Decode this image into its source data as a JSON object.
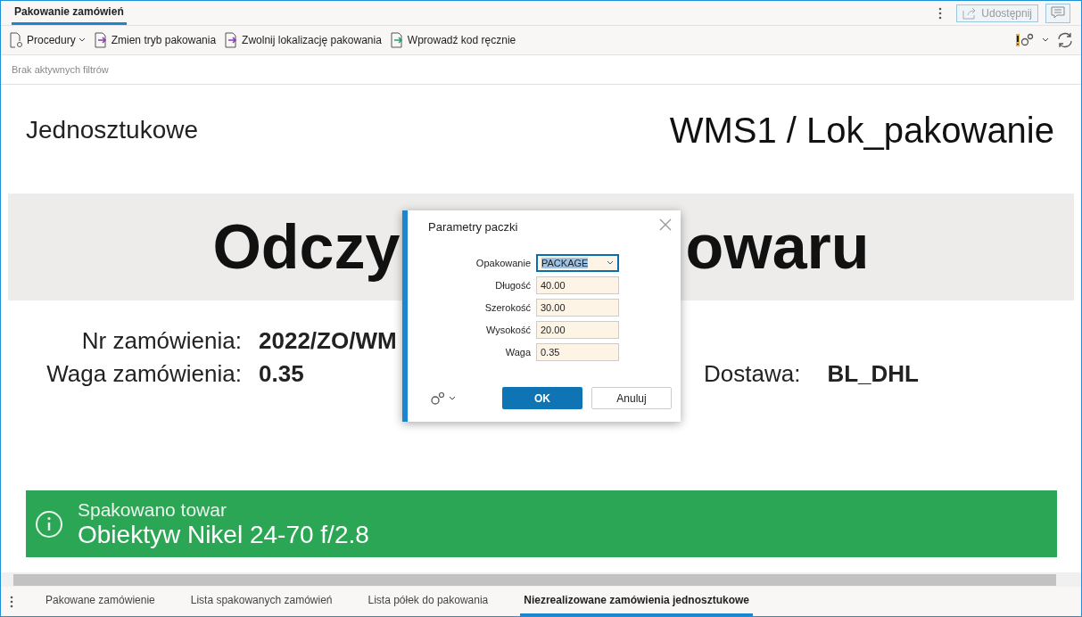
{
  "window": {
    "tabs": [
      {
        "label": "Pakowanie zamówień",
        "selected": true
      }
    ],
    "share_button": "Udostępnij"
  },
  "toolbar": {
    "items": [
      {
        "label": "Procedury",
        "kind": "menu"
      },
      {
        "label": "Zmien tryb pakowania",
        "kind": "action"
      },
      {
        "label": "Zwolnij lokalizację pakowania",
        "kind": "action"
      },
      {
        "label": "Wprowadź kod ręcznie",
        "kind": "enter"
      }
    ]
  },
  "filter_bar": "Brak aktywnych filtrów",
  "content": {
    "mode": "Jednosztukowe",
    "location": "WMS1 / Lok_pakowanie",
    "heading_left": "Odczy",
    "heading_right": "owaru",
    "info": [
      {
        "label": "Nr zamówienia:",
        "value": "2022/ZO/WM"
      },
      {
        "label": "Waga zamówienia:",
        "value": "0.35"
      }
    ],
    "delivery": {
      "label": "Dostawa:",
      "value": "BL_DHL"
    },
    "banner": {
      "title": "Spakowano towar",
      "item": "Obiektyw Nikel 24-70 f/2.8"
    }
  },
  "dialog": {
    "title": "Parametry paczki",
    "fields": [
      {
        "label": "Opakowanie",
        "value": "PACKAGE",
        "kind": "select"
      },
      {
        "label": "Długość",
        "value": "40.00",
        "kind": "text"
      },
      {
        "label": "Szerokość",
        "value": "30.00",
        "kind": "text"
      },
      {
        "label": "Wysokość",
        "value": "20.00",
        "kind": "text"
      },
      {
        "label": "Waga",
        "value": "0.35",
        "kind": "text"
      }
    ],
    "ok": "OK",
    "cancel": "Anuluj"
  },
  "bottom_tabs": [
    {
      "label": "Pakowane zamówienie",
      "selected": false
    },
    {
      "label": "Lista spakowanych zamówień",
      "selected": false
    },
    {
      "label": "Lista półek do pakowania",
      "selected": false
    },
    {
      "label": "Niezrealizowane zamówienia jednosztukowe",
      "selected": true
    }
  ]
}
